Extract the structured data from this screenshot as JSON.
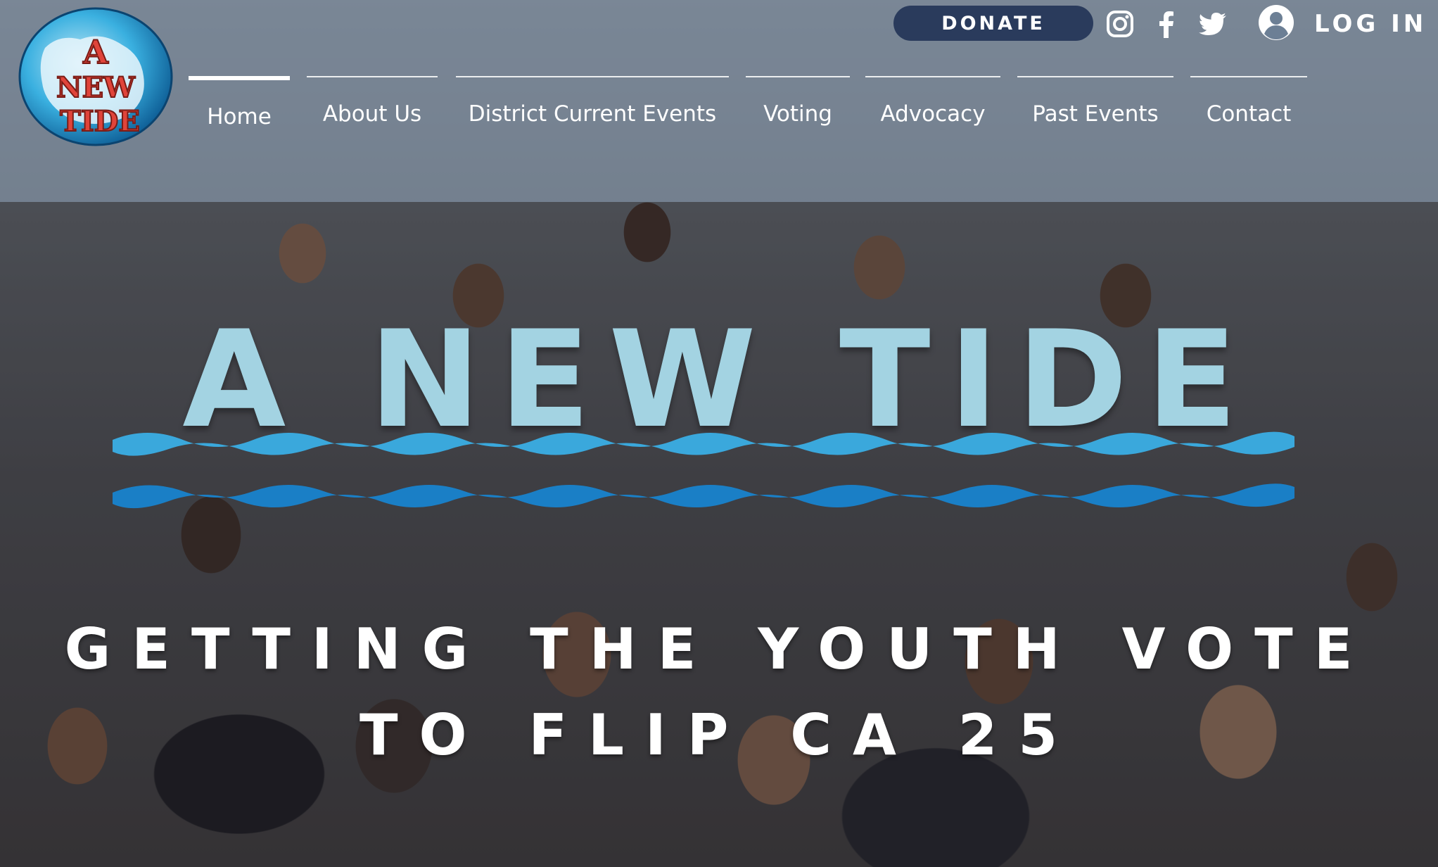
{
  "logo": {
    "text": "A NEW TIDE",
    "icon": "a-new-tide-logo"
  },
  "top_bar": {
    "donate_label": "DONATE",
    "social": [
      {
        "name": "instagram",
        "icon": "instagram-icon"
      },
      {
        "name": "facebook",
        "icon": "facebook-icon"
      },
      {
        "name": "twitter",
        "icon": "twitter-icon"
      }
    ],
    "login_label": "LOG IN",
    "login_icon": "user-avatar-icon"
  },
  "nav": {
    "items": [
      {
        "label": "Home",
        "active": true
      },
      {
        "label": "About Us",
        "active": false
      },
      {
        "label": "District Current Events",
        "active": false
      },
      {
        "label": "Voting",
        "active": false
      },
      {
        "label": "Advocacy",
        "active": false
      },
      {
        "label": "Past Events",
        "active": false
      },
      {
        "label": "Contact",
        "active": false
      }
    ]
  },
  "hero": {
    "title": "A NEW TIDE",
    "subtitle_line1": "GETTING THE YOUTH VOTE",
    "subtitle_line2": "TO FLIP CA 25"
  },
  "colors": {
    "title": "#a3d3e2",
    "donate_bg": "#2a3b5c",
    "wave_light": "#3aa8dc",
    "wave_dark": "#1a7fc6",
    "header_overlay": "#96aac0"
  }
}
